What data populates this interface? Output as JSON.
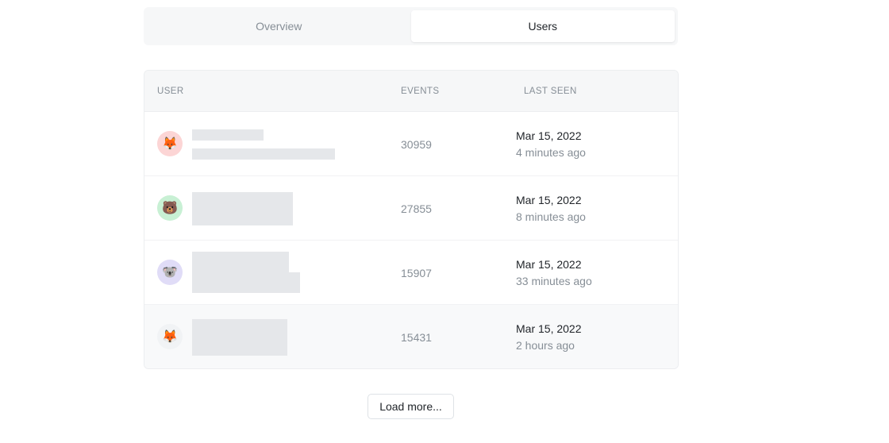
{
  "tabs": [
    {
      "label": "Overview",
      "active": false
    },
    {
      "label": "Users",
      "active": true
    }
  ],
  "table": {
    "headers": {
      "user": "USER",
      "events": "EVENTS",
      "last_seen": "LAST SEEN"
    },
    "rows": [
      {
        "avatar_icon": "fox-icon",
        "avatar_glyph": "🦊",
        "avatar_bg": "#fcd5d5",
        "events": "30959",
        "date": "Mar 15, 2022",
        "ago": "4 minutes ago"
      },
      {
        "avatar_icon": "bear-icon",
        "avatar_glyph": "🐻",
        "avatar_bg": "#c8f0d4",
        "events": "27855",
        "date": "Mar 15, 2022",
        "ago": "8 minutes ago"
      },
      {
        "avatar_icon": "koala-icon",
        "avatar_glyph": "🐨",
        "avatar_bg": "#e0dcf7",
        "events": "15907",
        "date": "Mar 15, 2022",
        "ago": "33 minutes ago"
      },
      {
        "avatar_icon": "fox-icon",
        "avatar_glyph": "🦊",
        "avatar_bg": "#f1f3f5",
        "events": "15431",
        "date": "Mar 15, 2022",
        "ago": "2 hours ago"
      }
    ]
  },
  "load_more_label": "Load more..."
}
